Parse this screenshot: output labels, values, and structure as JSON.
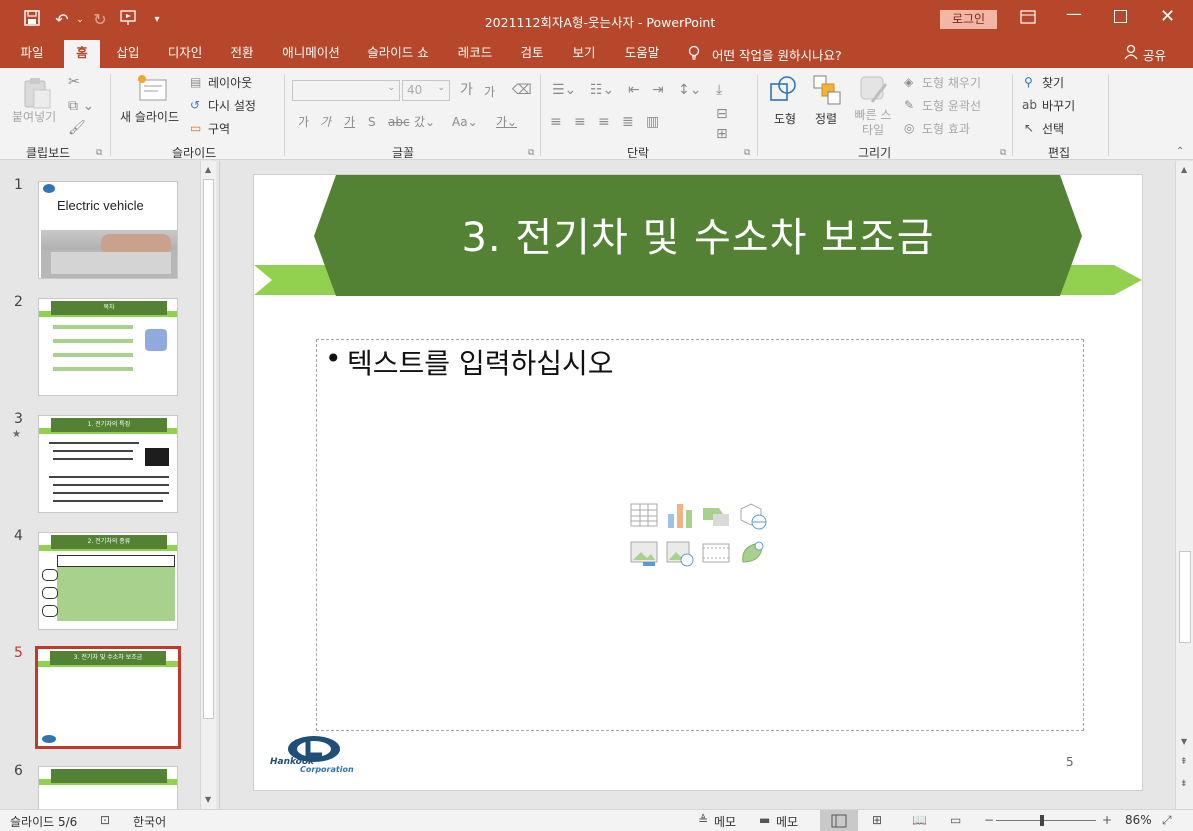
{
  "window": {
    "title": "2021112회자A형-웃는사자  -  PowerPoint",
    "login": "로그인",
    "share": "공유",
    "search_prompt": "어떤 작업을 원하시나요?"
  },
  "tabs": [
    "파일",
    "홈",
    "삽입",
    "디자인",
    "전환",
    "애니메이션",
    "슬라이드 쇼",
    "레코드",
    "검토",
    "보기",
    "도움말"
  ],
  "ribbon": {
    "clipboard": {
      "paste": "붙여넣기",
      "label": "클립보드"
    },
    "slides": {
      "new_slide": "새 슬라이드",
      "layout": "레이아웃",
      "reset": "다시 설정",
      "section": "구역",
      "label": "슬라이드"
    },
    "font": {
      "size": "40",
      "label": "글꼴"
    },
    "paragraph": {
      "label": "단락"
    },
    "drawing": {
      "shapes": "도형",
      "arrange": "정렬",
      "quick_styles": "빠른 스타일",
      "fill": "도형 채우기",
      "outline": "도형 윤곽선",
      "effects": "도형 효과",
      "label": "그리기"
    },
    "editing": {
      "find": "찾기",
      "replace": "바꾸기",
      "select": "선택",
      "label": "편집"
    }
  },
  "thumbnails": {
    "numbers": [
      "1",
      "2",
      "3",
      "4",
      "5",
      "6"
    ],
    "star": "★",
    "t1_title": "Electric vehicle",
    "t2_title": "목차",
    "t3_title": "1. 전기차의 특징",
    "t4_title": "2. 전기차의 종류",
    "t5_title": "3. 전기차 및 수소차 보조금"
  },
  "slide": {
    "title": "3. 전기차 및 수소차 보조금",
    "placeholder": "텍스트를 입력하십시오",
    "page_number": "5",
    "logo_text_1": "Hankook",
    "logo_text_2": "Corporation"
  },
  "status": {
    "slide_info": "슬라이드 5/6",
    "language": "한국어",
    "notes": "메모",
    "comments": "메모",
    "zoom": "86%"
  },
  "colors": {
    "accent": "#b7472a",
    "banner": "#548235",
    "stripe": "#92d050"
  }
}
